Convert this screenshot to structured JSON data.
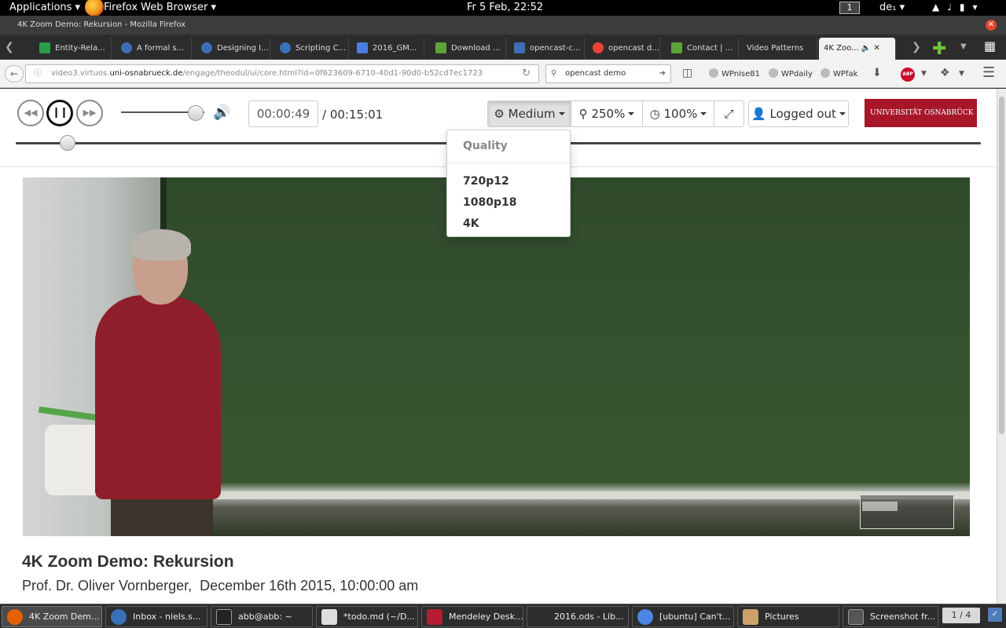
{
  "top_panel": {
    "applications": "Applications",
    "app_name": "Firefox Web Browser",
    "clock": "Fr  5 Feb, 22:52",
    "workspace": "1",
    "keyboard": "de₁"
  },
  "window": {
    "title": "4K Zoom Demo: Rekursion - Mozilla Firefox",
    "tabs": [
      {
        "label": "Entity-Rela...",
        "color": "#2a9d4a"
      },
      {
        "label": "A formal s...",
        "color": "#3b6fb6"
      },
      {
        "label": "Designing I...",
        "color": "#3b6fb6"
      },
      {
        "label": "Scripting C...",
        "color": "#3b6fb6"
      },
      {
        "label": "2016_GM...",
        "color": "#4a7fe0"
      },
      {
        "label": "Download ...",
        "color": "#5fa23a"
      },
      {
        "label": "opencast-c...",
        "color": "#3b6fb6"
      },
      {
        "label": "opencast d...",
        "color": "#ea4335"
      },
      {
        "label": "Contact | ...",
        "color": "#5fa23a"
      },
      {
        "label": "Video Patterns",
        "color": ""
      },
      {
        "label": "4K Zoo...",
        "color": ""
      }
    ]
  },
  "navbar": {
    "url_prefix": "video3.virtuos.",
    "url_host": "uni-osnabrueck.de",
    "url_path": "/engage/theodul/ui/core.html?id=0f623609-6710-40d1-90d0-b52cd7ec1723",
    "search_value": "opencast demo",
    "bookmarks": [
      "WPnise81",
      "WPdaily",
      "WPfak"
    ],
    "abp": "ABP"
  },
  "player": {
    "time_current": "00:00:49",
    "time_total": "/ 00:15:01",
    "quality_label": "Medium",
    "zoom_label": "250%",
    "speed_label": "100%",
    "login_label": "Logged out",
    "logo_text": "UNIVERSITÄT  OSNABRÜCK",
    "volume_level": 0.9,
    "seek_position": 0.054,
    "quality_menu": {
      "header": "Quality",
      "options": [
        "720p12",
        "1080p18",
        "4K"
      ]
    }
  },
  "video_info": {
    "title": "4K Zoom Demo: Rekursion",
    "subtitle": "Prof. Dr. Oliver Vornberger,  December 16th 2015, 10:00:00 am"
  },
  "taskbar": {
    "tasks": [
      {
        "label": "4K Zoom Dem...",
        "color": "#e66000"
      },
      {
        "label": "Inbox - niels.s...",
        "color": "#3b6fb6"
      },
      {
        "label": "abb@abb: ~",
        "color": "#222"
      },
      {
        "label": "*todo.md (~/D...",
        "color": "#ddd"
      },
      {
        "label": "Mendeley Desk...",
        "color": "#b61c32"
      },
      {
        "label": "2016.ods - Lib...",
        "color": "#2d2d2d"
      },
      {
        "label": "[ubuntu] Can't...",
        "color": "#4a86e8"
      },
      {
        "label": "Pictures",
        "color": "#c9a26a"
      },
      {
        "label": "Screenshot fr...",
        "color": "#555"
      }
    ],
    "pager": "1 / 4"
  }
}
